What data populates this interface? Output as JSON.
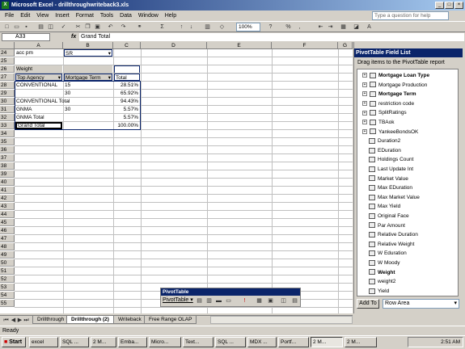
{
  "window": {
    "title": "Microsoft Excel - drillthroughwriteback3.xls"
  },
  "menu": [
    "File",
    "Edit",
    "View",
    "Insert",
    "Format",
    "Tools",
    "Data",
    "Window",
    "Help"
  ],
  "ask_placeholder": "Type a question for help",
  "toolbar": {
    "zoom": "100%"
  },
  "formula": {
    "namebox": "A33",
    "fx": "fx",
    "value": "Grand Total"
  },
  "columns": [
    "A",
    "B",
    "C",
    "D",
    "E",
    "F",
    "G",
    "H"
  ],
  "rows": [
    "24",
    "25",
    "26",
    "27",
    "28",
    "29",
    "30",
    "31",
    "32",
    "33",
    "34",
    "35",
    "36",
    "37",
    "38",
    "39",
    "40",
    "41",
    "42",
    "43",
    "44",
    "45",
    "46",
    "47",
    "48",
    "49",
    "50",
    "51",
    "52",
    "53",
    "54",
    "55"
  ],
  "cells": {
    "r24a": "acc pm",
    "r24b": "SR",
    "r26a": "Weight",
    "r27a": "Top Agency",
    "r27b": "Mortgage Term",
    "r27c": "Total",
    "r28a": "CONVENTIONAL",
    "r28b": "15",
    "r28c": "28.51%",
    "r29b": "30",
    "r29c": "65.92%",
    "r30a": "CONVENTIONAL Total",
    "r30c": "94.43%",
    "r31a": "GNMA",
    "r31b": "30",
    "r31c": "5.57%",
    "r32a": "GNMA Total",
    "r32c": "5.57%",
    "r33a": "Grand Total",
    "r33c": "100.00%"
  },
  "pivot_pane": {
    "title": "PivotTable Field List",
    "hint": "Drag items to the PivotTable report",
    "fields": [
      {
        "label": "Mortgage Loan Type",
        "kind": "dim",
        "bold": true
      },
      {
        "label": "Mortgage Production",
        "kind": "dim",
        "bold": false
      },
      {
        "label": "Mortgage Term",
        "kind": "dim",
        "bold": true
      },
      {
        "label": "restriction code",
        "kind": "dim",
        "bold": false
      },
      {
        "label": "SplitRatings",
        "kind": "dim",
        "bold": false
      },
      {
        "label": "TBAok",
        "kind": "dim",
        "bold": false
      },
      {
        "label": "YankeeBondsOK",
        "kind": "dim",
        "bold": false
      },
      {
        "label": "Duration2",
        "kind": "measure",
        "bold": false
      },
      {
        "label": "EDuration",
        "kind": "measure",
        "bold": false
      },
      {
        "label": "Holdings Count",
        "kind": "measure",
        "bold": false
      },
      {
        "label": "Last Update Int",
        "kind": "measure",
        "bold": false
      },
      {
        "label": "Market Value",
        "kind": "measure",
        "bold": false
      },
      {
        "label": "Max EDuration",
        "kind": "measure",
        "bold": false
      },
      {
        "label": "Max Market Value",
        "kind": "measure",
        "bold": false
      },
      {
        "label": "Max Yield",
        "kind": "measure",
        "bold": false
      },
      {
        "label": "Original Face",
        "kind": "measure",
        "bold": false
      },
      {
        "label": "Par Amount",
        "kind": "measure",
        "bold": false
      },
      {
        "label": "Relative Duration",
        "kind": "measure",
        "bold": false
      },
      {
        "label": "Relative Weight",
        "kind": "measure",
        "bold": false
      },
      {
        "label": "W Eduration",
        "kind": "measure",
        "bold": false
      },
      {
        "label": "W Moody",
        "kind": "measure",
        "bold": false
      },
      {
        "label": "Weight",
        "kind": "measure",
        "bold": true
      },
      {
        "label": "weight2",
        "kind": "measure",
        "bold": false
      },
      {
        "label": "Yield",
        "kind": "measure",
        "bold": false
      }
    ],
    "add_to": "Add To",
    "area": "Row Area"
  },
  "pivot_toolbar": {
    "title": "PivotTable",
    "menu": "PivotTable ▾"
  },
  "sheet_tabs": [
    "Drillthrough",
    "Drillthrough (2)",
    "Writeback",
    "Free Range OLAP"
  ],
  "active_tab": 1,
  "status": "Ready",
  "taskbar": {
    "start": "Start",
    "tasks": [
      "excel",
      "SQL ...",
      "2 M...",
      "Emba...",
      "Micro...",
      "Text...",
      "SQL ...",
      "MDX ...",
      "Portf...",
      "2 M...",
      "2 M..."
    ],
    "clock": "2:51 AM"
  }
}
